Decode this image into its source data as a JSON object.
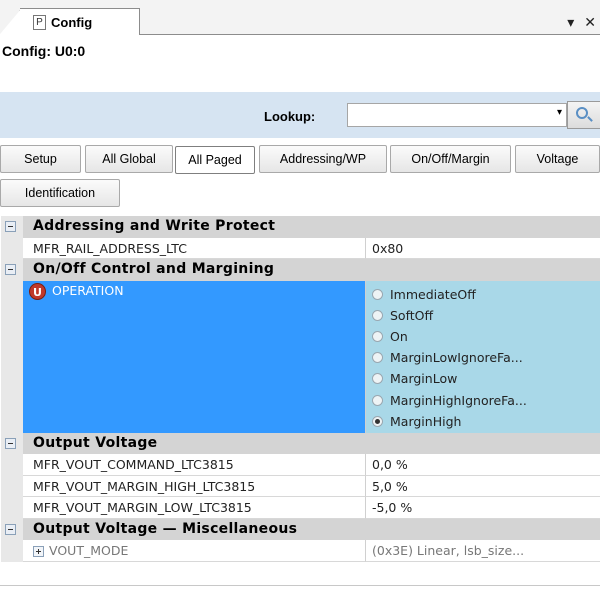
{
  "tab": {
    "icon_letter": "P",
    "title": "Config"
  },
  "window_buttons": {
    "menu": "▾",
    "close": "✕"
  },
  "config_title": "Config: U0:0",
  "lookup": {
    "label": "Lookup:",
    "value": "",
    "dropdown_arrow": "▾"
  },
  "filters": [
    "Setup",
    "All Global",
    "All Paged",
    "Addressing/WP",
    "On/Off/Margin",
    "Voltage",
    "Identification"
  ],
  "active_filter": "All Paged",
  "grid": {
    "cat_addressing": "Addressing and Write Protect",
    "rail_name": "MFR_RAIL_ADDRESS_LTC",
    "rail_value": "0x80",
    "cat_onoff": "On/Off Control and Margining",
    "operation": {
      "icon": "U",
      "name": "OPERATION",
      "options": [
        "ImmediateOff",
        "SoftOff",
        "On",
        "MarginLowIgnoreFa...",
        "MarginLow",
        "MarginHighIgnoreFa...",
        "MarginHigh"
      ],
      "selected": "MarginHigh"
    },
    "cat_output": "Output Voltage",
    "vout_command_name": "MFR_VOUT_COMMAND_LTC3815",
    "vout_command_value": "0,0 %",
    "vout_margin_high_name": "MFR_VOUT_MARGIN_HIGH_LTC3815",
    "vout_margin_high_value": "5,0 %",
    "vout_margin_low_name": "MFR_VOUT_MARGIN_LOW_LTC3815",
    "vout_margin_low_value": "-5,0 %",
    "cat_misc": "Output Voltage — Miscellaneous",
    "vout_mode_name": "VOUT_MODE",
    "vout_mode_value": "(0x3E) Linear, lsb_size..."
  },
  "colors": {
    "selection_blue": "#3399ff",
    "options_bg": "#a9d8e8",
    "lookup_bar": "#d6e4f2",
    "category_bg": "#d4d4d4",
    "operation_icon": "#c0392b"
  }
}
